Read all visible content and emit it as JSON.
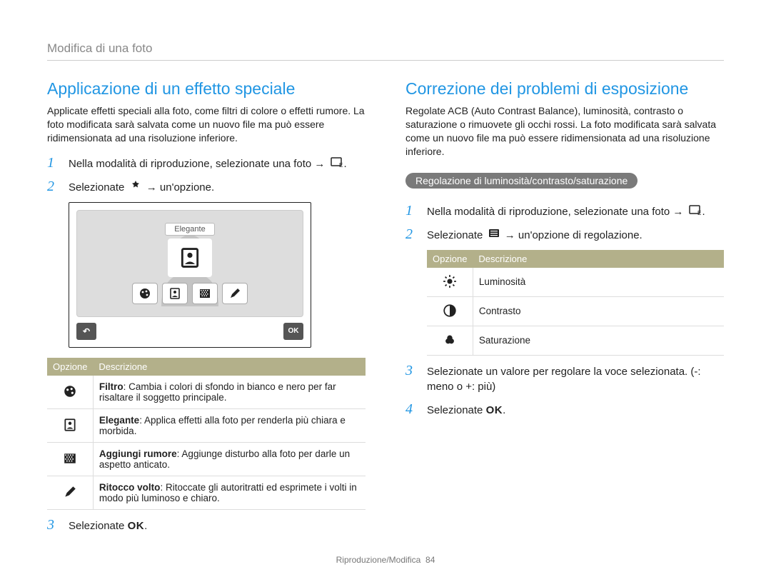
{
  "header": "Modifica di una foto",
  "left": {
    "title": "Applicazione di un effetto speciale",
    "intro": "Applicate effetti speciali alla foto, come filtri di colore o effetti rumore. La foto modificata sarà salvata come un nuovo file ma può essere ridimensionata ad una risoluzione inferiore.",
    "step1": "Nella modalità di riproduzione, selezionate una foto → ",
    "step2a": "Selezionate ",
    "step2b": " → un'opzione.",
    "mock_tag": "Elegante",
    "table": {
      "h1": "Opzione",
      "h2": "Descrizione",
      "rows": [
        {
          "icon": "palette",
          "bold": "Filtro",
          "rest": ": Cambia i colori di sfondo in bianco e nero per far risaltare il soggetto principale."
        },
        {
          "icon": "portrait",
          "bold": "Elegante",
          "rest": ": Applica effetti alla foto per renderla più chiara e morbida."
        },
        {
          "icon": "noise",
          "bold": "Aggiungi rumore",
          "rest": ": Aggiunge disturbo alla foto per darle un aspetto anticato."
        },
        {
          "icon": "brush",
          "bold": "Ritocco volto",
          "rest": ": Ritoccate gli autoritratti ed esprimete i volti in modo più luminoso e chiaro."
        }
      ]
    },
    "step3": "Selezionate ",
    "ok": "OK"
  },
  "right": {
    "title": "Correzione dei problemi di esposizione",
    "intro": "Regolate ACB (Auto Contrast Balance), luminosità, contrasto o saturazione o rimuovete gli occhi rossi. La foto modificata sarà salvata come un nuovo file ma può essere ridimensionata ad una risoluzione inferiore.",
    "pill": "Regolazione di luminosità/contrasto/saturazione",
    "step1": "Nella modalità di riproduzione, selezionate una foto → ",
    "step2a": "Selezionate ",
    "step2b": " → un'opzione di regolazione.",
    "table": {
      "h1": "Opzione",
      "h2": "Descrizione",
      "rows": [
        {
          "icon": "sun",
          "label": "Luminosità"
        },
        {
          "icon": "contrast",
          "label": "Contrasto"
        },
        {
          "icon": "sat",
          "label": "Saturazione"
        }
      ]
    },
    "step3": "Selezionate un valore per regolare la voce selezionata. (-: meno o +: più)",
    "step4": "Selezionate ",
    "ok": "OK"
  },
  "footer": {
    "section": "Riproduzione/Modifica",
    "page": "84"
  }
}
